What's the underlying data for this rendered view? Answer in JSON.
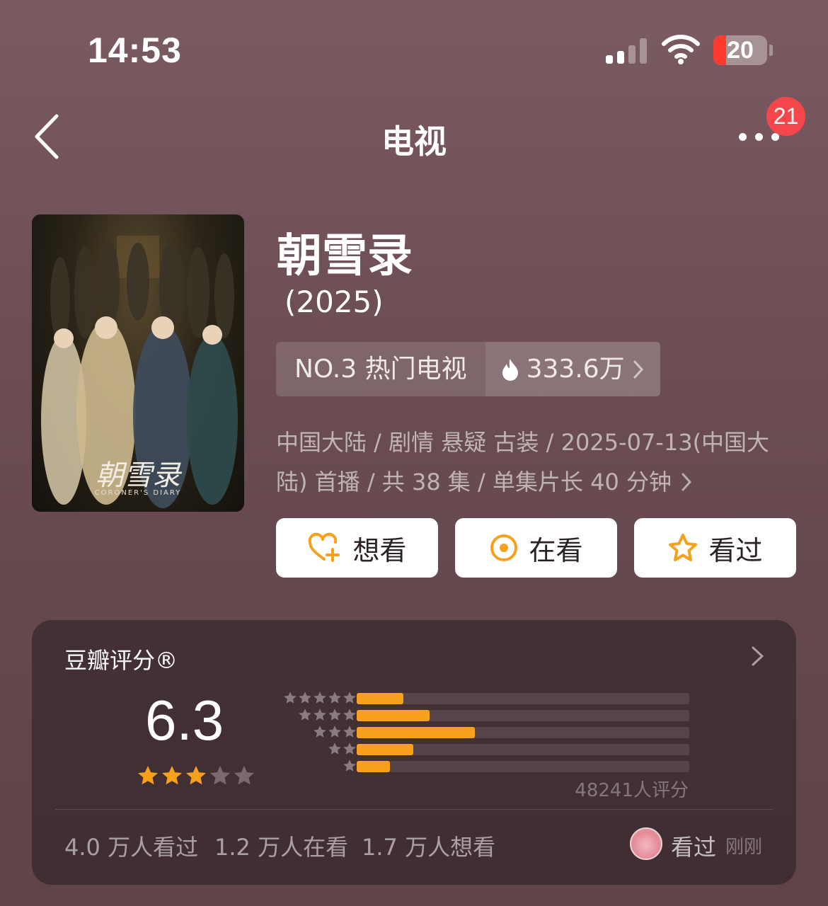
{
  "status_bar": {
    "time": "14:53",
    "battery": "20",
    "signal_bars": 2
  },
  "nav": {
    "title": "电视",
    "badge_count": "21",
    "back_icon": "chevron-left-icon",
    "more_icon": "more-dots-icon"
  },
  "movie": {
    "title": "朝雪录",
    "year": "(2025)",
    "rank_label": "NO.3 热门电视",
    "heat_value": "333.6万",
    "meta_line1": "中国大陆 / 剧情 悬疑 古装 / 2025-07-13(中国大",
    "meta_line2": "陆) 首播 / 共 38 集 / 单集片长 40 分钟",
    "poster_logo": "朝雪录",
    "poster_subtitle": "CORONER'S DIARY"
  },
  "actions": [
    {
      "label": "想看",
      "icon": "heart-plus-icon"
    },
    {
      "label": "在看",
      "icon": "target-icon"
    },
    {
      "label": "看过",
      "icon": "star-outline-icon"
    }
  ],
  "rating": {
    "title": "豆瓣评分®",
    "score": "6.3",
    "stars_filled": 3,
    "stars_total": 5,
    "distribution": [
      {
        "stars": 5,
        "fraction": 0.14
      },
      {
        "stars": 4,
        "fraction": 0.22
      },
      {
        "stars": 3,
        "fraction": 0.355
      },
      {
        "stars": 2,
        "fraction": 0.17
      },
      {
        "stars": 1,
        "fraction": 0.1
      }
    ],
    "count_text": "48241人评分",
    "seen_count": "4.0 万人看过",
    "watching_count": "1.2 万人在看",
    "want_count": "1.7 万人想看",
    "my_status": "看过",
    "my_time": "刚刚"
  },
  "colors": {
    "accent": "#f7a01c",
    "badge": "#f5474b",
    "star_empty": "#7a6a6d"
  }
}
